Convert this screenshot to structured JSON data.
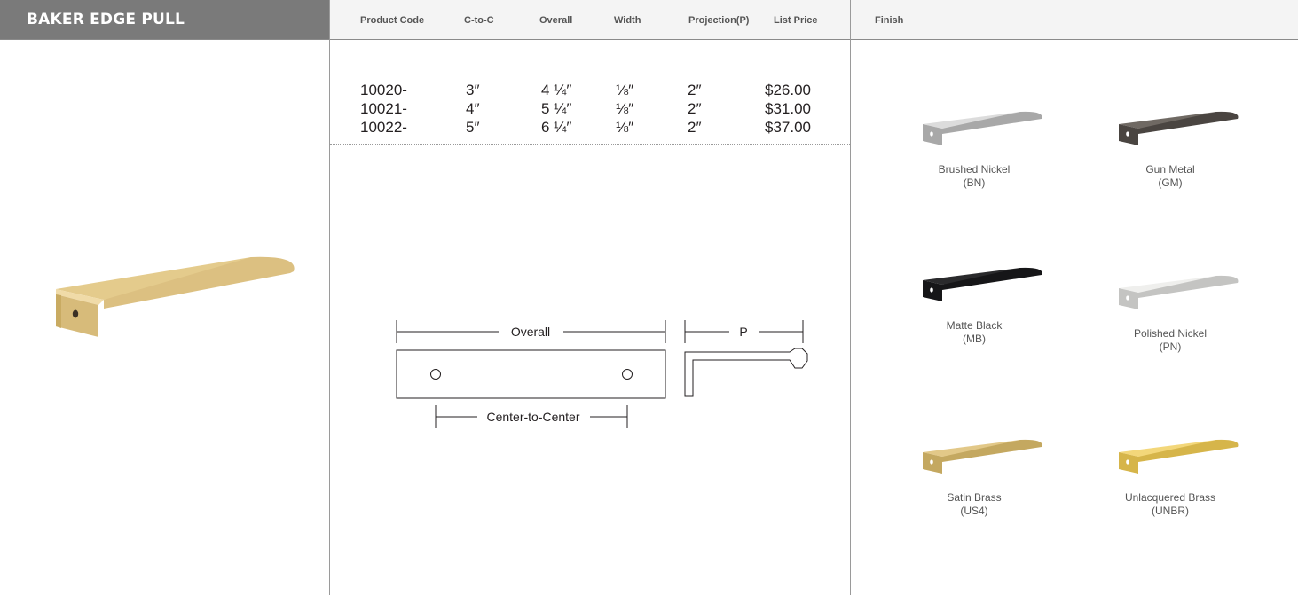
{
  "title": "BAKER EDGE PULL",
  "columns": {
    "code": "Product Code",
    "ctoc": "C-to-C",
    "overall": "Overall",
    "width": "Width",
    "projection": "Projection(P)",
    "price": "List Price",
    "finish": "Finish"
  },
  "rows": [
    {
      "code": "10020-",
      "ctoc": "3″",
      "overall": "4 ¼″",
      "width": "⅛″",
      "projection": "2″",
      "price": "$26.00"
    },
    {
      "code": "10021-",
      "ctoc": "4″",
      "overall": "5 ¼″",
      "width": "⅛″",
      "projection": "2″",
      "price": "$31.00"
    },
    {
      "code": "10022-",
      "ctoc": "5″",
      "overall": "6 ¼″",
      "width": "⅛″",
      "projection": "2″",
      "price": "$37.00"
    }
  ],
  "diagram": {
    "overall_label": "Overall",
    "center_label": "Center-to-Center",
    "projection_label": "P"
  },
  "finishes": [
    {
      "name": "Brushed Nickel",
      "code": "(BN)",
      "color": "#dcdcdc",
      "shade": "#a8a8a8"
    },
    {
      "name": "Gun Metal",
      "code": "(GM)",
      "color": "#6f6963",
      "shade": "#4a4541"
    },
    {
      "name": "Matte Black",
      "code": "(MB)",
      "color": "#2a2a2c",
      "shade": "#161618"
    },
    {
      "name": "Polished Nickel",
      "code": "(PN)",
      "color": "#efefed",
      "shade": "#c4c4c2"
    },
    {
      "name": "Satin Brass",
      "code": "(US4)",
      "color": "#e2c888",
      "shade": "#c4a860"
    },
    {
      "name": "Unlacquered Brass",
      "code": "(UNBR)",
      "color": "#f3d77a",
      "shade": "#d6b54a"
    }
  ],
  "product_color": "#e4cb8c",
  "product_shade": "#c9ab62"
}
